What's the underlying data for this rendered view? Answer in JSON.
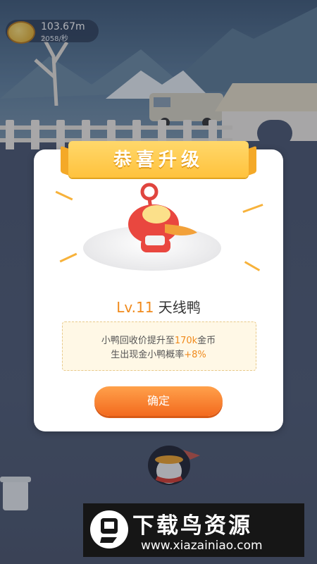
{
  "hud": {
    "coins": "103.67m",
    "rate": "2058/秒"
  },
  "dialog": {
    "title": "恭喜升级",
    "level_prefix": "Lv.11",
    "duck_name": "天线鸭",
    "line1_a": "小鸭回收价提升至",
    "line1_value": "170k",
    "line1_b": "金币",
    "line2_a": "生出现金小鸭概率",
    "line2_value": "+8%",
    "confirm_label": "确定"
  },
  "watermark": {
    "title": "下载鸟资源",
    "url": "www.xiazainiao.com"
  },
  "colors": {
    "accent": "#f08a1c",
    "button": "#f36a1e",
    "ribbon": "#ffc23d"
  },
  "icons": {
    "coin": "coin-icon",
    "duck": "antenna-duck-icon",
    "penguin": "penguin-icon",
    "trash": "trash-can-icon",
    "logo": "xiazainiao-logo-icon"
  }
}
